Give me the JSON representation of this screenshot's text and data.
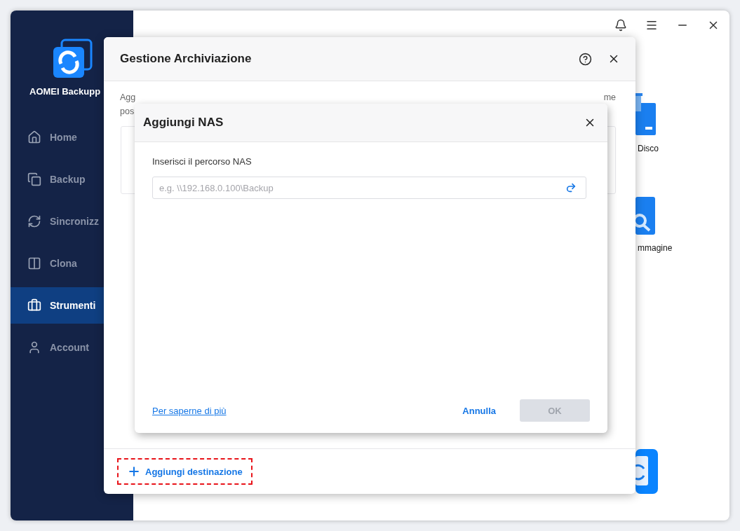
{
  "app": {
    "name": "AOMEI Backupp"
  },
  "sidebar": {
    "items": [
      {
        "label": "Home",
        "kind": "home",
        "selected": false
      },
      {
        "label": "Backup",
        "kind": "backup",
        "selected": false
      },
      {
        "label": "Sincronizz",
        "kind": "sync",
        "selected": false
      },
      {
        "label": "Clona",
        "kind": "clone",
        "selected": false
      },
      {
        "label": "Strumenti",
        "kind": "tools",
        "selected": true
      },
      {
        "label": "Account",
        "kind": "account",
        "selected": false
      }
    ]
  },
  "tools": [
    {
      "kind": "disk",
      "label": "Disco"
    },
    {
      "kind": "image",
      "label": "mmagine"
    },
    {
      "kind": "sync"
    }
  ],
  "storage_dialog": {
    "title": "Gestione Archiviazione",
    "description_fragments": [
      "Agg",
      "me",
      "pos"
    ],
    "add_button": "Aggiungi destinazione"
  },
  "nas_dialog": {
    "title": "Aggiungi NAS",
    "field_label": "Inserisci il percorso NAS",
    "path_field": {
      "placeholder": "e.g. \\\\192.168.0.100\\Backup"
    },
    "link": "Per saperne di più",
    "cancel": "Annulla",
    "ok": {
      "label": "OK",
      "disabled": true
    }
  }
}
